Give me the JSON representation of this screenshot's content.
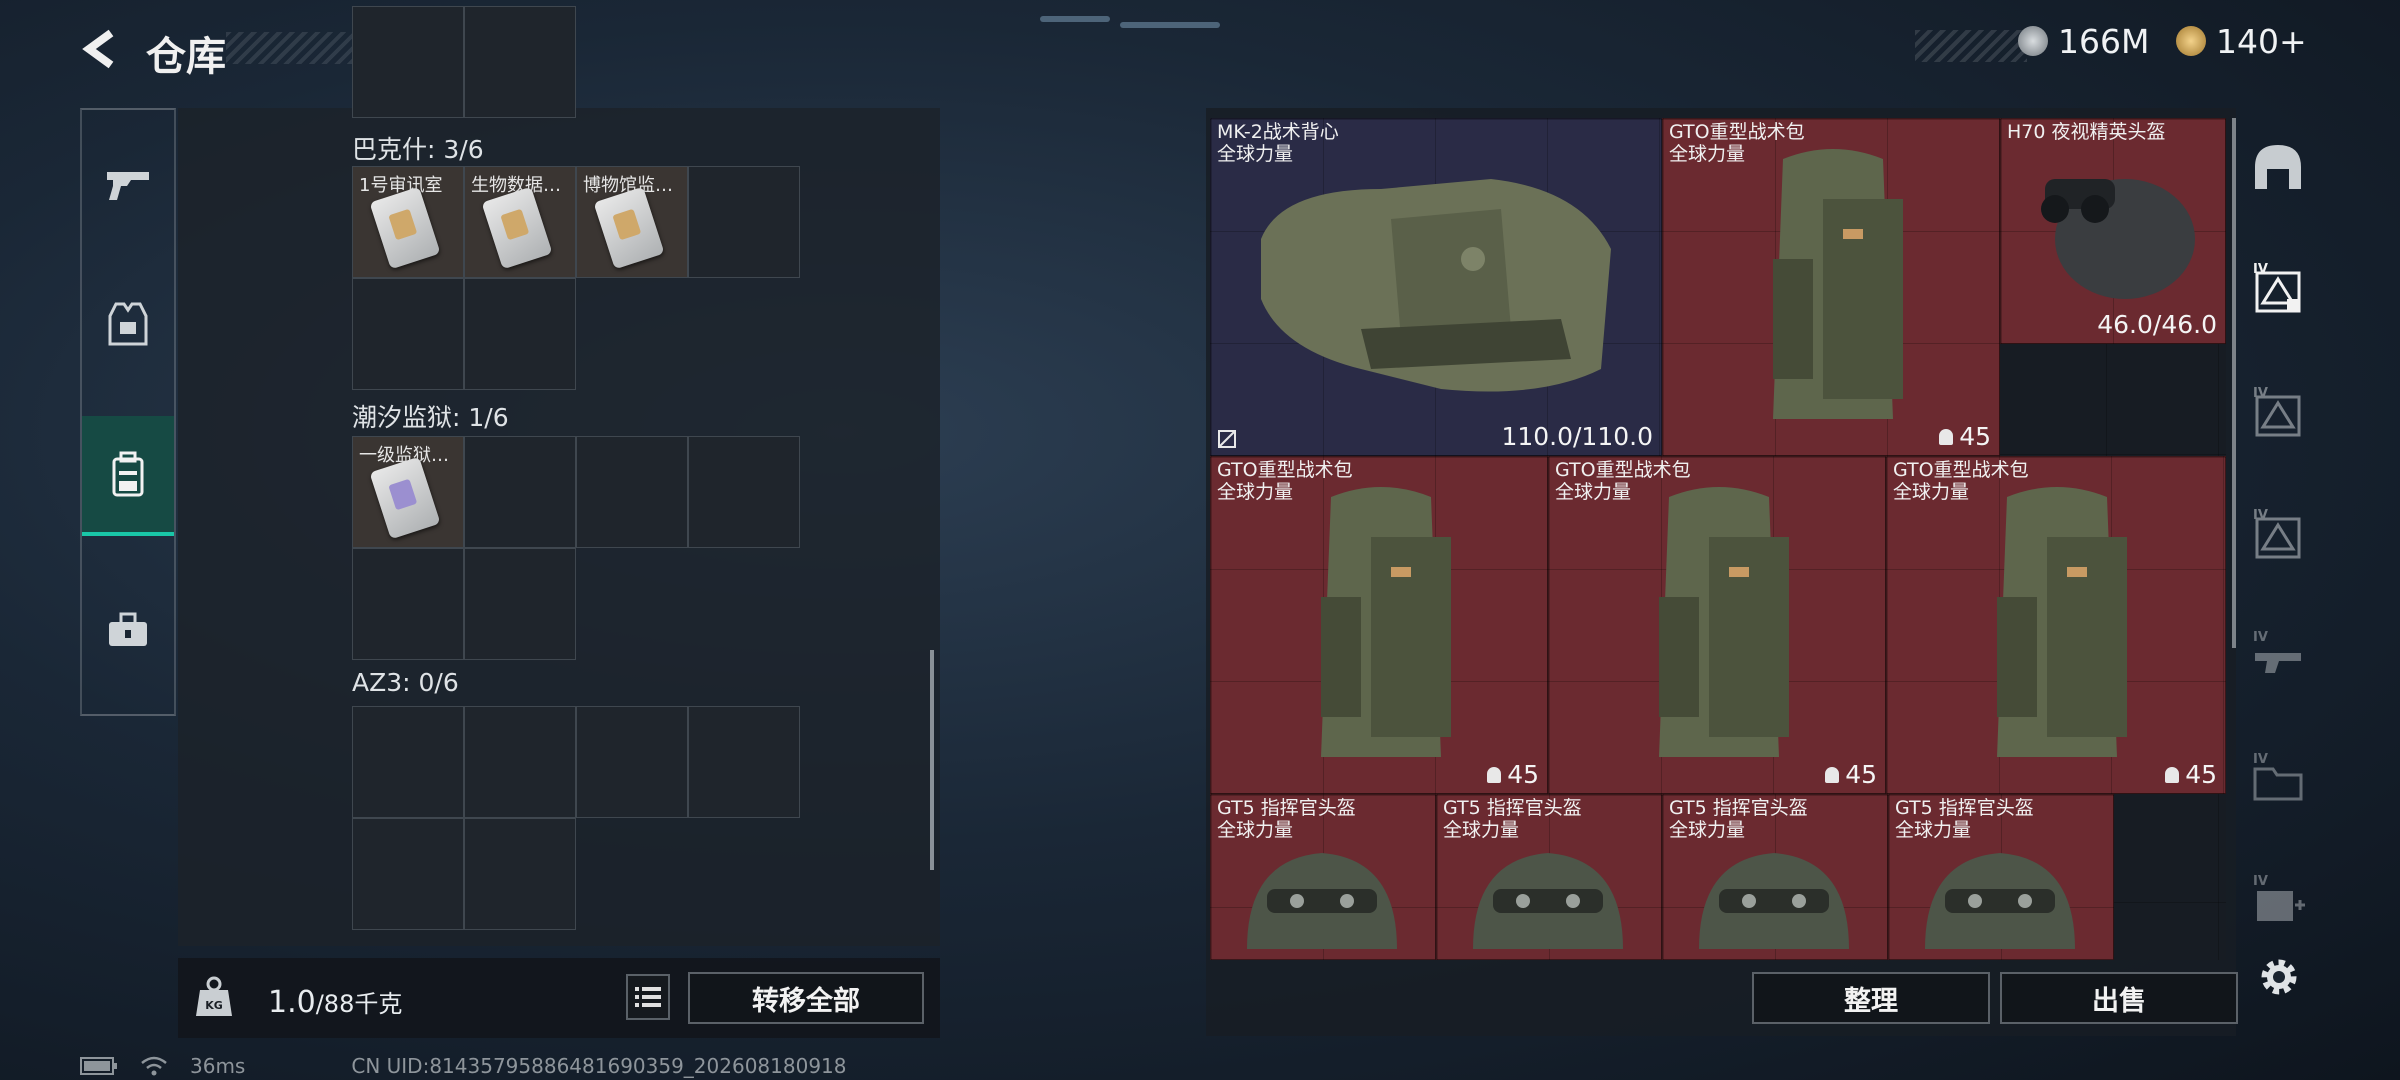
{
  "header": {
    "title": "仓库",
    "currency_silver": "166M",
    "currency_gold": "140+"
  },
  "left_nav": {
    "items": [
      {
        "icon": "weapon-icon"
      },
      {
        "icon": "armor-icon"
      },
      {
        "icon": "backpack-icon",
        "active": true
      },
      {
        "icon": "toolbox-icon"
      }
    ]
  },
  "storage": {
    "sections": [
      {
        "label": "巴克什: 3/6",
        "slots": [
          "1号审讯室",
          "生物数据…",
          "博物馆监…",
          "",
          "",
          ""
        ]
      },
      {
        "label": "潮汐监狱: 1/6",
        "slots": [
          "一级监狱…",
          "",
          "",
          "",
          "",
          ""
        ]
      },
      {
        "label": "AZ3: 0/6",
        "slots": [
          "",
          "",
          "",
          "",
          "",
          ""
        ]
      }
    ],
    "weight_current": "1.0",
    "weight_max": "/88千克",
    "transfer_all_label": "转移全部"
  },
  "inventory": {
    "items": [
      {
        "name": "MK-2战术背心",
        "sub": "全球力量",
        "value": "110.0/110.0",
        "color": "navy"
      },
      {
        "name": "GTO重型战术包",
        "sub": "全球力量",
        "qty": "45",
        "color": "red"
      },
      {
        "name": "H70 夜视精英头盔",
        "sub": "",
        "value": "46.0/46.0",
        "color": "red"
      },
      {
        "name": "GTO重型战术包",
        "sub": "全球力量",
        "qty": "45",
        "color": "red"
      },
      {
        "name": "GTO重型战术包",
        "sub": "全球力量",
        "qty": "45",
        "color": "red"
      },
      {
        "name": "GTO重型战术包",
        "sub": "全球力量",
        "qty": "45",
        "color": "red"
      },
      {
        "name": "GT5 指挥官头盔",
        "sub": "全球力量",
        "color": "red"
      },
      {
        "name": "GT5 指挥官头盔",
        "sub": "全球力量",
        "color": "red"
      },
      {
        "name": "GT5 指挥官头盔",
        "sub": "全球力量",
        "color": "red"
      },
      {
        "name": "GT5 指挥官头盔",
        "sub": "全球力量",
        "color": "red"
      }
    ],
    "sort_label": "整理",
    "sell_label": "出售"
  },
  "right_nav": {
    "items": [
      {
        "icon": "helmet-slot-icon",
        "tier": ""
      },
      {
        "icon": "armor-slot-icon",
        "tier": "IV"
      },
      {
        "icon": "armor-slot-icon",
        "tier": "IV"
      },
      {
        "icon": "armor-slot-icon",
        "tier": "IV"
      },
      {
        "icon": "weapon-slot-icon",
        "tier": "IV"
      },
      {
        "icon": "folder-slot-icon",
        "tier": "IV"
      },
      {
        "icon": "medkit-slot-icon",
        "tier": "IV"
      }
    ]
  },
  "status_bar": {
    "ping": "36ms",
    "uid": "CN UID:8143579588648169035​9_202608180918"
  },
  "colors": {
    "accent": "#19c7a8",
    "rarity_red": "#6b2a30",
    "rarity_navy": "#2a2b46"
  }
}
